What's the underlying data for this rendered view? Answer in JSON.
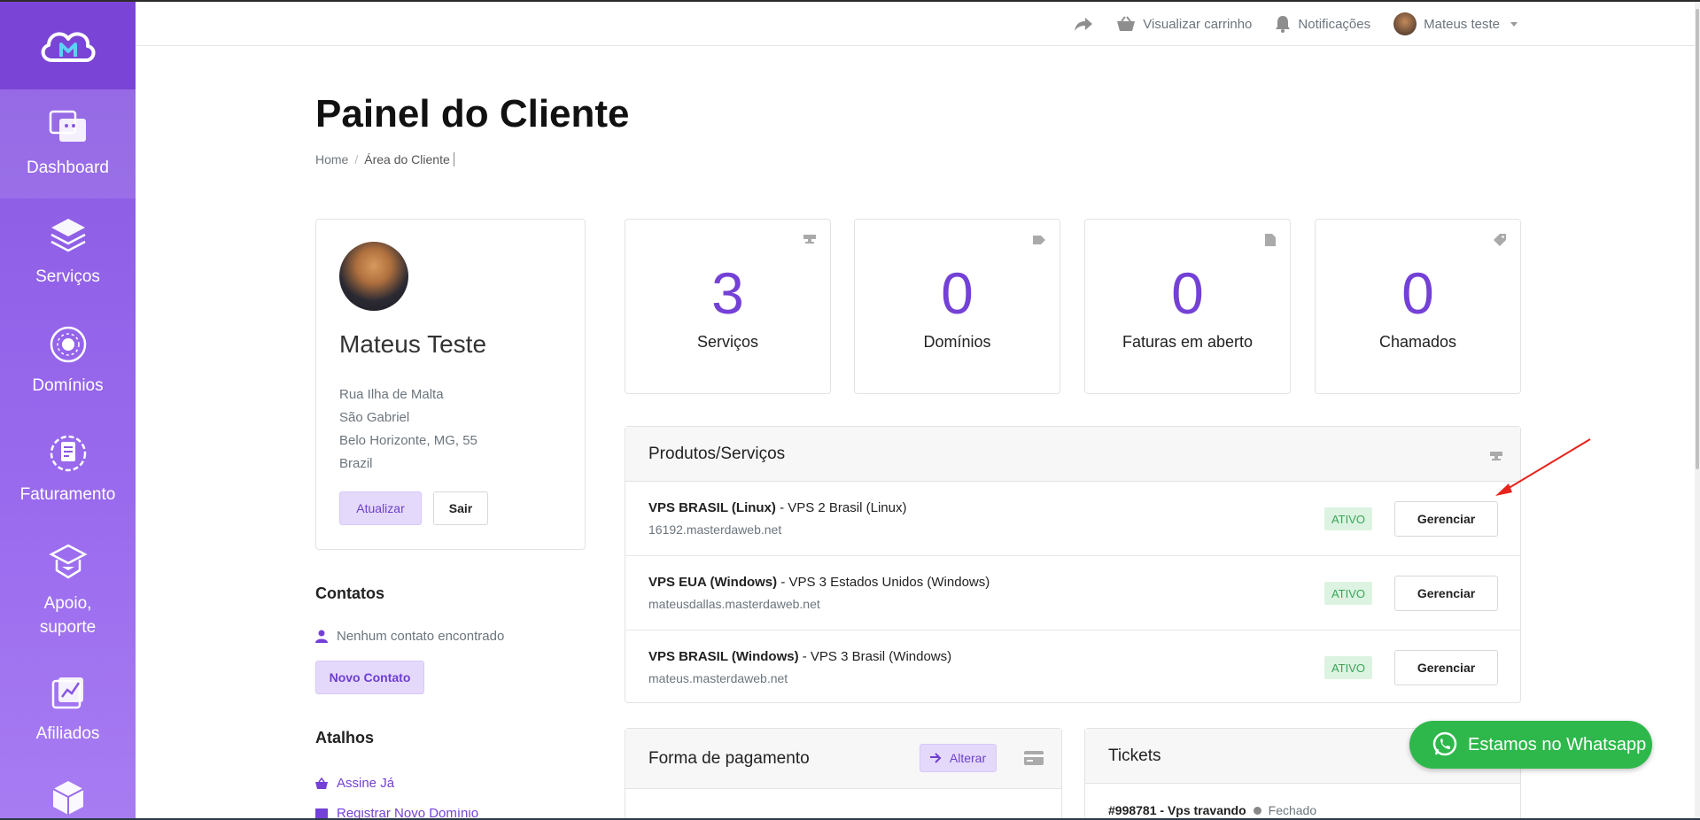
{
  "topbar": {
    "share_icon": "share-arrow-icon",
    "cart_label": "Visualizar carrinho",
    "notifications_label": "Notificações",
    "user_label": "Mateus teste"
  },
  "sidebar": {
    "items": [
      {
        "label": "Dashboard",
        "icon": "dashboard-icon"
      },
      {
        "label": "Serviços",
        "icon": "services-icon"
      },
      {
        "label": "Domínios",
        "icon": "domains-icon"
      },
      {
        "label": "Faturamento",
        "icon": "billing-icon"
      },
      {
        "label_line1": "Apoio,",
        "label_line2": "suporte",
        "icon": "support-icon"
      },
      {
        "label": "Afiliados",
        "icon": "affiliates-icon"
      }
    ]
  },
  "header": {
    "title": "Painel do Cliente",
    "breadcrumb": [
      "Home",
      "Área do Cliente"
    ]
  },
  "profile": {
    "name": "Mateus Teste",
    "address": [
      "Rua Ilha de Malta",
      "São Gabriel",
      "Belo Horizonte, MG, 55",
      "Brazil"
    ],
    "update_label": "Atualizar",
    "logout_label": "Sair"
  },
  "contacts": {
    "title": "Contatos",
    "empty_text": "Nenhum contato encontrado",
    "new_label": "Novo Contato"
  },
  "shortcuts": {
    "title": "Atalhos",
    "items": [
      "Assine Já",
      "Registrar Novo Domínio"
    ]
  },
  "stats": [
    {
      "value": "3",
      "label": "Serviços",
      "icon": "server-icon"
    },
    {
      "value": "0",
      "label": "Domínios",
      "icon": "tag-icon"
    },
    {
      "value": "0",
      "label": "Faturas em aberto",
      "icon": "document-icon"
    },
    {
      "value": "0",
      "label": "Chamados",
      "icon": "ticket-icon"
    }
  ],
  "products": {
    "title": "Produtos/Serviços",
    "rows": [
      {
        "name": "VPS BRASIL (Linux)",
        "plan": " - VPS 2 Brasil (Linux)",
        "host": "16192.masterdaweb.net",
        "status": "ATIVO",
        "action": "Gerenciar"
      },
      {
        "name": "VPS EUA (Windows)",
        "plan": " - VPS 3 Estados Unidos (Windows)",
        "host": "mateusdallas.masterdaweb.net",
        "status": "ATIVO",
        "action": "Gerenciar"
      },
      {
        "name": "VPS BRASIL (Windows)",
        "plan": " - VPS 3 Brasil (Windows)",
        "host": "mateus.masterdaweb.net",
        "status": "ATIVO",
        "action": "Gerenciar"
      }
    ]
  },
  "payment": {
    "title": "Forma de pagamento",
    "alter_label": "Alterar"
  },
  "tickets": {
    "title": "Tickets",
    "first": {
      "id": "#998781 - Vps travando",
      "status": "Fechado"
    }
  },
  "whatsapp": {
    "label": "Estamos no Whatsapp"
  },
  "colors": {
    "accent": "#7441d6",
    "sidebar": "#8757e0",
    "active_badge_bg": "#ddf3e1",
    "whatsapp": "#2eb84b"
  }
}
